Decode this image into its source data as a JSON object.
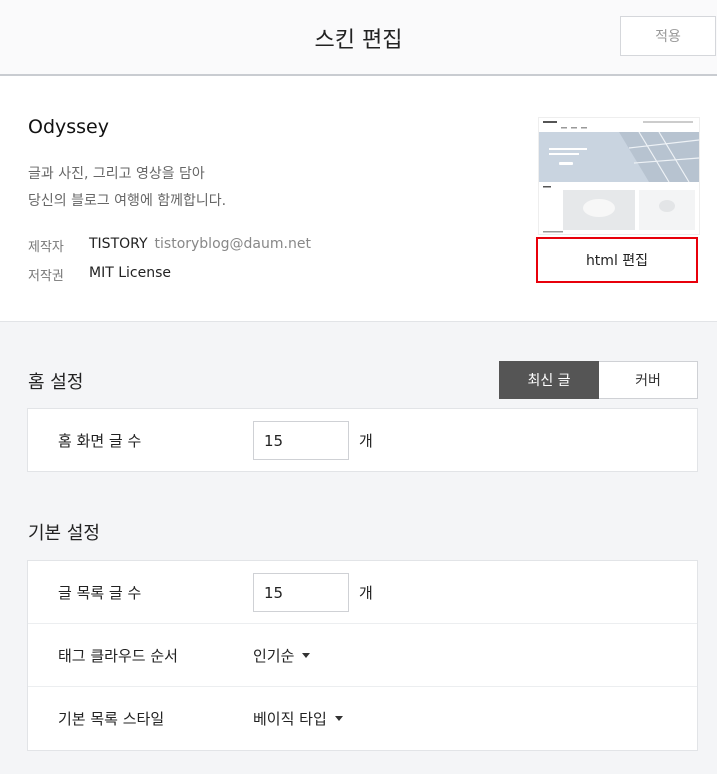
{
  "header": {
    "title": "스킨 편집",
    "apply_label": "적용"
  },
  "skin": {
    "name": "Odyssey",
    "description_line1": "글과 사진, 그리고 영상을 담아",
    "description_line2": "당신의 블로그 여행에 함께합니다.",
    "author_label": "제작자",
    "author": "TISTORY",
    "author_email": "tistoryblog@daum.net",
    "license_label": "저작권",
    "license": "MIT License",
    "html_edit_label": "html 편집"
  },
  "home_settings": {
    "title": "홈 설정",
    "toggle": {
      "options": [
        "최신 글",
        "커버"
      ],
      "selected": "최신 글"
    },
    "rows": [
      {
        "label": "홈 화면 글 수",
        "value": "15",
        "unit": "개"
      }
    ]
  },
  "basic_settings": {
    "title": "기본 설정",
    "rows": [
      {
        "label": "글 목록 글 수",
        "value": "15",
        "unit": "개"
      },
      {
        "label": "태그 클라우드 순서",
        "value": "인기순"
      },
      {
        "label": "기본 목록 스타일",
        "value": "베이직 타입"
      }
    ]
  },
  "icons": {
    "dropdown": "caret-down-icon"
  },
  "colors": {
    "toggle_active_bg": "#555555",
    "highlight_border": "#e8000b"
  }
}
